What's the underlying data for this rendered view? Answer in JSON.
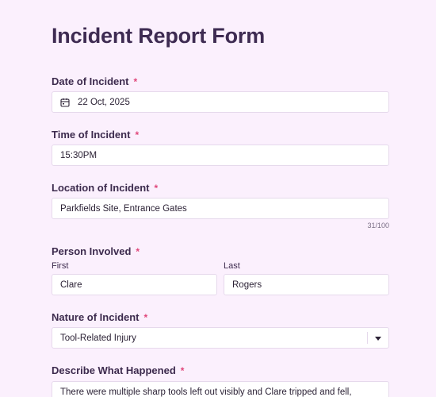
{
  "form": {
    "title": "Incident Report Form",
    "required_marker": "*",
    "date": {
      "label": "Date of Incident",
      "value": "22 Oct, 2025"
    },
    "time": {
      "label": "Time of Incident",
      "value": "15:30PM"
    },
    "location": {
      "label": "Location of Incident",
      "value": "Parkfields Site, Entrance Gates",
      "counter": "31/100"
    },
    "person": {
      "label": "Person Involved",
      "first_label": "First",
      "first_value": "Clare",
      "last_label": "Last",
      "last_value": "Rogers"
    },
    "nature": {
      "label": "Nature of Incident",
      "value": "Tool-Related Injury"
    },
    "describe": {
      "label": "Describe What Happened",
      "value": "There were multiple sharp tools left out visibly and Clare tripped and fell,"
    }
  },
  "colors": {
    "background": "#fbf0fd",
    "required": "#e0467a",
    "title": "#3e2b52"
  },
  "icons": {
    "date_icon": "calendar-icon",
    "select_icon": "chevron-down-icon"
  }
}
